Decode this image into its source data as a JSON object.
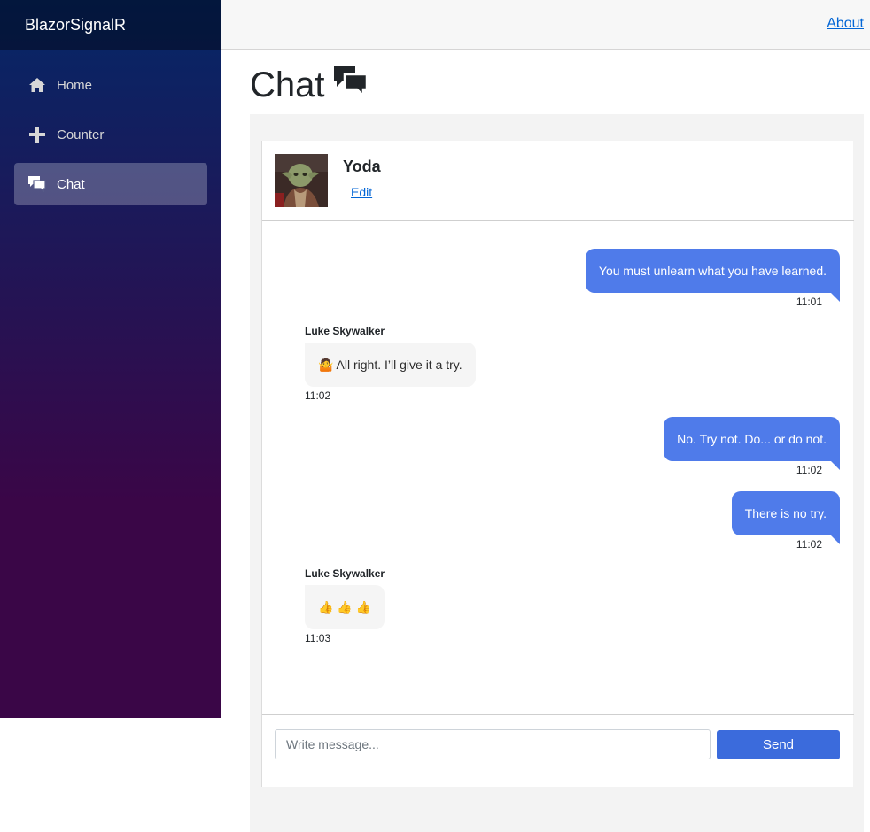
{
  "app": {
    "brand": "BlazorSignalR"
  },
  "sidebar": {
    "items": [
      {
        "label": "Home",
        "icon": "home-icon",
        "active": false
      },
      {
        "label": "Counter",
        "icon": "plus-icon",
        "active": false
      },
      {
        "label": "Chat",
        "icon": "chat-icon",
        "active": true
      }
    ]
  },
  "top_row": {
    "about_label": "About"
  },
  "page": {
    "title": "Chat",
    "title_icon": "chat-bubbles-icon"
  },
  "chat": {
    "user": {
      "name": "Yoda",
      "edit_label": "Edit",
      "avatar": "yoda-avatar"
    },
    "messages": [
      {
        "direction": "out",
        "text": "You must unlearn what you have learned.",
        "time": "11:01"
      },
      {
        "direction": "in",
        "sender": "Luke Skywalker",
        "text": "🤷 All right. I’ll give it a try.",
        "time": "11:02"
      },
      {
        "direction": "out",
        "text": "No. Try not. Do... or do not.",
        "time": "11:02"
      },
      {
        "direction": "out",
        "text": "There is no try.",
        "time": "11:02"
      },
      {
        "direction": "in",
        "sender": "Luke Skywalker",
        "text": "👍 👍 👍",
        "time": "11:03"
      }
    ],
    "input": {
      "placeholder": "Write message...",
      "value": ""
    },
    "send_label": "Send"
  },
  "colors": {
    "sidebar_top": "#052767",
    "sidebar_bottom": "#3a0647",
    "outgoing_bubble": "#4f7bea",
    "incoming_bubble": "#f5f5f5",
    "send_button": "#3b6bdc",
    "link": "#0366d6"
  }
}
